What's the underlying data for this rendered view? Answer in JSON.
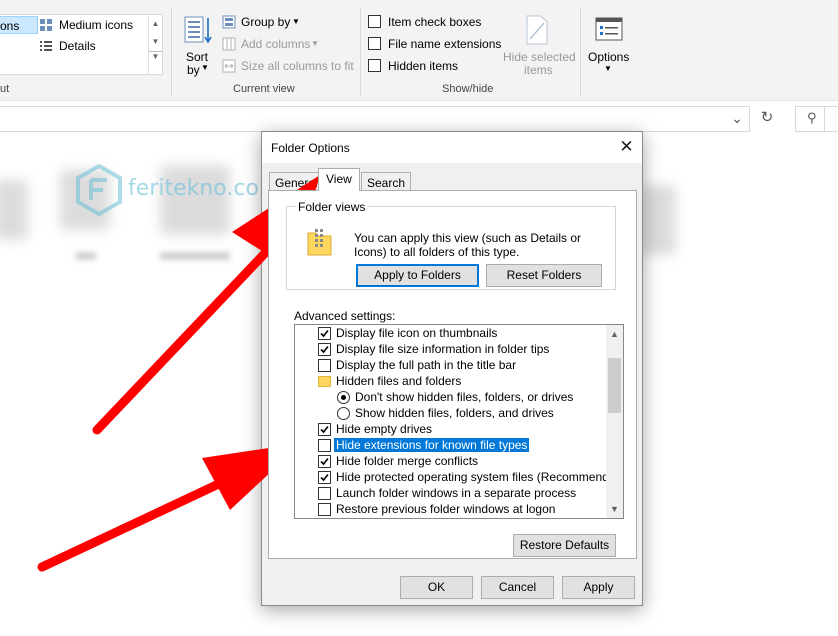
{
  "ribbon": {
    "layout": {
      "selected_label": "ons",
      "medium_icons": "Medium icons",
      "details": "Details"
    },
    "sort_by": {
      "line1": "Sort",
      "line2": "by"
    },
    "group_by": "Group by",
    "add_columns": "Add columns",
    "size_all_columns": "Size all columns to fit",
    "current_view_label": "Current view",
    "item_check_boxes": "Item check boxes",
    "file_name_extensions": "File name extensions",
    "hidden_items": "Hidden items",
    "hide_selected": {
      "line1": "Hide selected",
      "line2": "items"
    },
    "show_hide_label": "Show/hide",
    "options": "Options",
    "partial_group_label": "ut"
  },
  "watermark": {
    "text": "feritekno.com"
  },
  "dialog": {
    "title": "Folder Options",
    "tabs": [
      "General",
      "View",
      "Search"
    ],
    "active_tab": "View",
    "folder_views": {
      "label": "Folder views",
      "description": "You can apply this view (such as Details or Icons) to all folders of this type.",
      "apply_button": "Apply to Folders",
      "reset_button": "Reset Folders"
    },
    "advanced_label": "Advanced settings:",
    "settings": [
      {
        "kind": "checkbox",
        "label": "Display file icon on thumbnails",
        "checked": true
      },
      {
        "kind": "checkbox",
        "label": "Display file size information in folder tips",
        "checked": true
      },
      {
        "kind": "checkbox",
        "label": "Display the full path in the title bar",
        "checked": false
      },
      {
        "kind": "folder",
        "label": "Hidden files and folders"
      },
      {
        "kind": "radio",
        "label": "Don't show hidden files, folders, or drives",
        "checked": true
      },
      {
        "kind": "radio",
        "label": "Show hidden files, folders, and drives",
        "checked": false
      },
      {
        "kind": "checkbox",
        "label": "Hide empty drives",
        "checked": true
      },
      {
        "kind": "checkbox",
        "label": "Hide extensions for known file types",
        "checked": false,
        "selected": true
      },
      {
        "kind": "checkbox",
        "label": "Hide folder merge conflicts",
        "checked": true
      },
      {
        "kind": "checkbox",
        "label": "Hide protected operating system files (Recommended)",
        "checked": true
      },
      {
        "kind": "checkbox",
        "label": "Launch folder windows in a separate process",
        "checked": false
      },
      {
        "kind": "checkbox",
        "label": "Restore previous folder windows at logon",
        "checked": false
      }
    ],
    "restore_defaults": "Restore Defaults",
    "ok": "OK",
    "cancel": "Cancel",
    "apply": "Apply"
  },
  "colors": {
    "selection": "#0078d7",
    "arrow": "#ff0000",
    "ribbon_bg": "#f3f3f3"
  }
}
